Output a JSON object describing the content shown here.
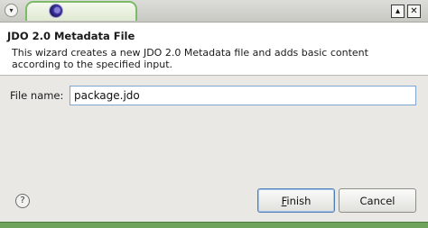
{
  "window": {
    "menu_icon": "chevron-down-icon",
    "app_icon": "eclipse-icon",
    "maximize_icon": "maximize-icon",
    "close_icon": "close-icon"
  },
  "header": {
    "title": "JDO 2.0 Metadata File",
    "description": "This wizard creates a new JDO 2.0 Metadata file and adds basic content according to the specified input."
  },
  "form": {
    "file_name_label": "File name:",
    "file_name_value": "package.jdo"
  },
  "footer": {
    "help_icon": "help-icon",
    "finish_mnemonic": "F",
    "finish_rest": "inish",
    "cancel_label": "Cancel"
  },
  "colors": {
    "accent_green": "#7cba6a",
    "input_border": "#7fa6cf",
    "default_button": "#4f7fb8"
  }
}
